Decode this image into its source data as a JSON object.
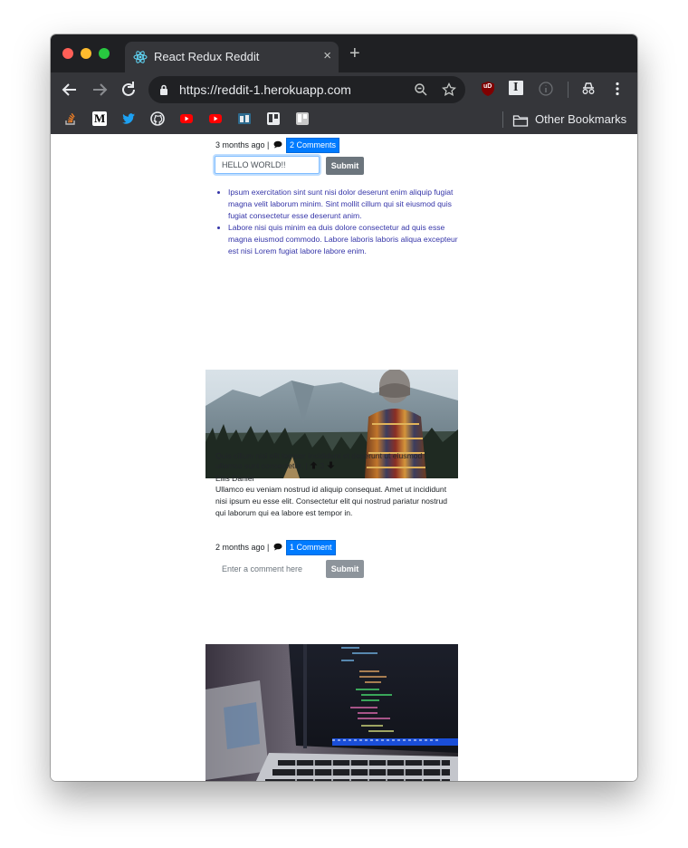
{
  "browser": {
    "tab_title": "React Redux Reddit",
    "tab_close": "×",
    "new_tab": "+",
    "url_scheme": "https://",
    "url_host": "reddit-1.herokuapp.com",
    "other_bookmarks": "Other Bookmarks",
    "extension_ublock_label": "uD",
    "extension_instapaper_label": "I",
    "bookmarks": [
      "stackoverflow-icon",
      "medium-icon",
      "twitter-icon",
      "github-icon",
      "youtube-icon",
      "youtube-icon",
      "readwise-icon",
      "trello-icon",
      "trello-icon"
    ]
  },
  "posts": [
    {
      "time": "3 months ago |",
      "comments_badge": "2 Comments",
      "comment_input_value": "HELLO WORLD!!",
      "submit_label": "Submit",
      "comments": [
        "Ipsum exercitation sint sunt nisi dolor deserunt enim aliquip fugiat magna velit laborum minim. Sint mollit cillum qui sit eiusmod quis fugiat consectetur esse deserunt anim.",
        "Labore nisi quis minim ea duis dolore consectetur ad quis esse magna eiusmod commodo. Labore laboris laboris aliqua excepteur est nisi Lorem fugiat labore labore enim."
      ]
    },
    {
      "image": "mountain-hiker-photo",
      "title": "Quis cillum nisi elit tempor incididunt et deserunt ut eiusmod ullamco sunt consectetur. |",
      "votes": "3",
      "author": "Ellis Daniel",
      "body": "Ullamco eu veniam nostrud id aliquip consequat. Amet ut incididunt nisi ipsum eu esse elit. Consectetur elit qui nostrud pariatur nostrud qui laborum qui ea labore est tempor in.",
      "time": "2 months ago |",
      "comments_badge": "1 Comment",
      "comment_input_placeholder": "Enter a comment here",
      "submit_label": "Submit"
    },
    {
      "image": "laptop-code-photo"
    }
  ],
  "colors": {
    "badge": "#007bff",
    "comment_link": "#3535a8",
    "tab_bg": "#35363a",
    "titlebar_bg": "#1f2023"
  }
}
